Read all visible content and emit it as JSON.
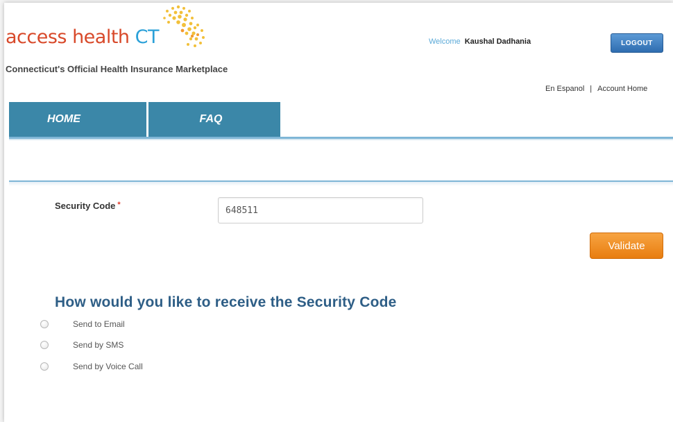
{
  "header": {
    "logo_main": "access health",
    "logo_ct": "CT",
    "tagline": "Connecticut's Official Health Insurance Marketplace",
    "welcome_label": "Welcome",
    "user_name": "Kaushal Dadhania",
    "logout_label": "LOGOUT",
    "links": {
      "espanol": "En Espanol",
      "separator": "|",
      "account_home": "Account Home"
    }
  },
  "nav": {
    "tabs": [
      {
        "label": "HOME"
      },
      {
        "label": "FAQ"
      }
    ]
  },
  "form": {
    "security_code_label": "Security Code",
    "required_marker": "*",
    "security_code_value": "648511",
    "validate_label": "Validate",
    "receive_heading": "How would you like to receive the Security Code",
    "options": [
      {
        "label": "Send to Email",
        "selected": false
      },
      {
        "label": "Send by SMS",
        "selected": false
      },
      {
        "label": "Send by Voice Call",
        "selected": false
      }
    ]
  },
  "colors": {
    "brand_orange": "#d8492a",
    "brand_blue": "#2aa0d8",
    "tab_blue": "#3b87a8",
    "validate_orange": "#f08b1f",
    "heading_blue": "#2e5e86"
  }
}
